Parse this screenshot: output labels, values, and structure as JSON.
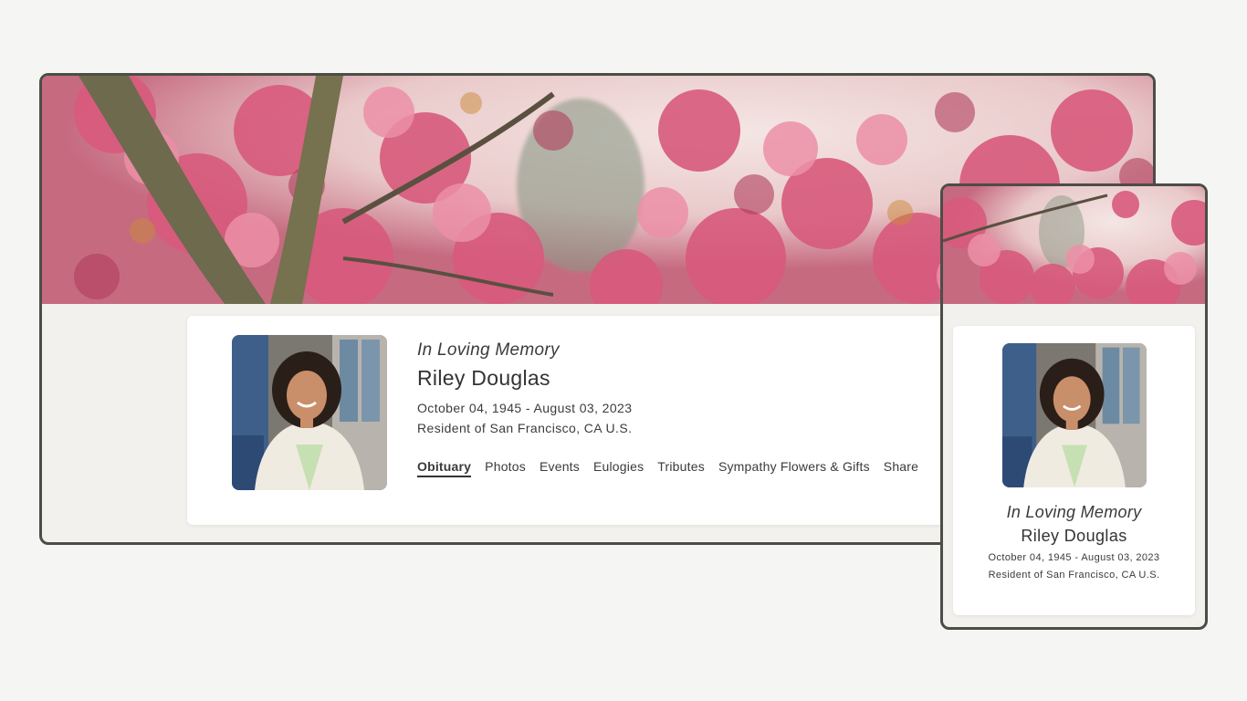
{
  "memorial": {
    "kicker": "In Loving Memory",
    "name": "Riley Douglas",
    "dates": "October 04, 1945 - August 03, 2023",
    "resident": "Resident of San Francisco, CA U.S."
  },
  "nav": {
    "tabs": [
      {
        "label": "Obituary",
        "active": true
      },
      {
        "label": "Photos",
        "active": false
      },
      {
        "label": "Events",
        "active": false
      },
      {
        "label": "Eulogies",
        "active": false
      },
      {
        "label": "Tributes",
        "active": false
      },
      {
        "label": "Sympathy Flowers & Gifts",
        "active": false
      },
      {
        "label": "Share",
        "active": false
      }
    ]
  },
  "theme": {
    "frame_border": "#4c4d47",
    "page_background": "#f5f5f4",
    "panel_background": "#f2f1ed",
    "blossom_pink": "#d9577a"
  },
  "images": {
    "banner": "cherry-blossom-banner",
    "portrait": "portrait-photo"
  }
}
